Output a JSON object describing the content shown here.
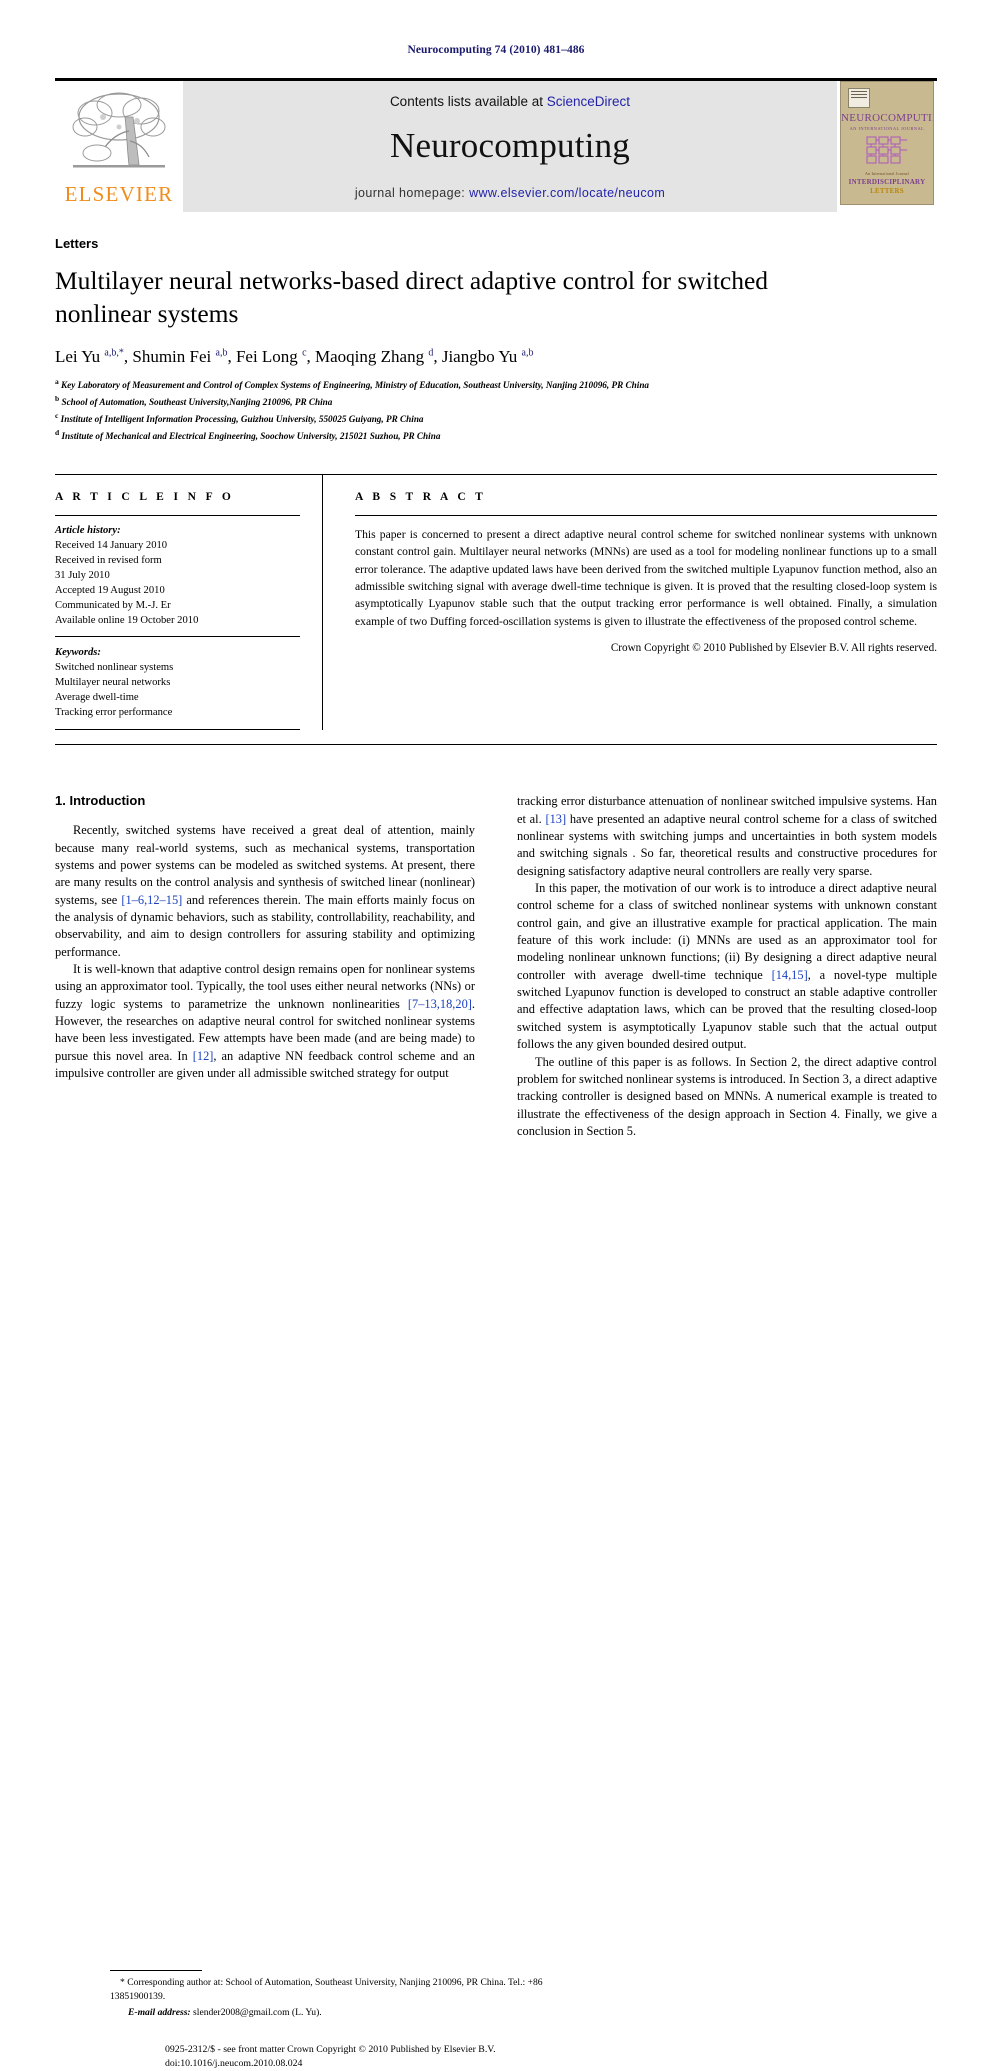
{
  "running_head": "Neurocomputing 74 (2010) 481–486",
  "masthead": {
    "publisher": "ELSEVIER",
    "contents_prefix": "Contents lists available at ",
    "contents_link": "ScienceDirect",
    "journal_name": "Neurocomputing",
    "homepage_prefix": "journal homepage: ",
    "homepage_url": "www.elsevier.com/locate/neucom",
    "cover": {
      "title": "NEUROCOMPUTING",
      "subtitle": "AN INTERNATIONAL JOURNAL",
      "foot_small": "An International Journal",
      "foot_line1": "INTERDISCIPLINARY",
      "foot_line2": "LETTERS"
    },
    "link_color": "#2222aa",
    "banner_color": "#e4e4e4",
    "elsevier_orange": "#F08C1B"
  },
  "article": {
    "kicker": "Letters",
    "title": "Multilayer neural networks-based direct adaptive control for switched nonlinear systems",
    "authors_html": "Lei Yu <sup>a,b,</sup><sup>*</sup>, Shumin Fei <sup>a,b</sup>, Fei Long <sup>c</sup>, Maoqing Zhang <sup>d</sup>, Jiangbo Yu <sup>a,b</sup>",
    "affiliations": [
      {
        "mark": "a",
        "text": "Key Laboratory of Measurement and Control of Complex Systems of Engineering, Ministry of Education, Southeast University, Nanjing 210096, PR China"
      },
      {
        "mark": "b",
        "text": "School of Automation, Southeast University,Nanjing 210096, PR China"
      },
      {
        "mark": "c",
        "text": "Institute of Intelligent Information Processing, Guizhou University, 550025 Guiyang, PR China"
      },
      {
        "mark": "d",
        "text": "Institute of Mechanical and Electrical Engineering, Soochow University, 215021 Suzhou, PR China"
      }
    ]
  },
  "article_info": {
    "heading": "A R T I C L E   I N F O",
    "history_label": "Article history:",
    "history": [
      "Received 14 January 2010",
      "Received in revised form",
      "31 July 2010",
      "Accepted 19 August 2010",
      "Communicated by M.-J. Er",
      "Available online 19 October 2010"
    ],
    "keywords_label": "Keywords:",
    "keywords": [
      "Switched nonlinear systems",
      "Multilayer neural networks",
      "Average dwell-time",
      "Tracking error performance"
    ]
  },
  "abstract": {
    "heading": "A B S T R A C T",
    "text": "This paper is concerned to present a direct adaptive neural control scheme for switched nonlinear systems with unknown constant control gain. Multilayer neural networks (MNNs) are used as a tool for modeling nonlinear functions up to a small error tolerance. The adaptive updated laws have been derived from the switched multiple Lyapunov function method, also an admissible switching signal with average dwell-time technique is given. It is proved that the resulting closed-loop system is asymptotically Lyapunov stable such that the output tracking error performance is well obtained. Finally, a simulation example of two Duffing forced-oscillation systems is given to illustrate the effectiveness of the proposed control scheme.",
    "copyright": "Crown Copyright © 2010 Published by Elsevier B.V. All rights reserved."
  },
  "body": {
    "section_heading": "1.  Introduction",
    "left_paragraphs": [
      "Recently, switched systems have received a great deal of attention, mainly because many real-world systems, such as mechanical systems, transportation systems and power systems can be modeled as switched systems. At present, there are many results on the control analysis and synthesis of switched linear (nonlinear) systems, see [1–6,12–15] and references therein. The main efforts mainly focus on the analysis of dynamic behaviors, such as stability, controllability, reachability, and observability, and aim to design controllers for assuring stability and optimizing performance.",
      "It is well-known that adaptive control design remains open for nonlinear systems using an approximator tool. Typically, the tool uses either neural networks (NNs) or fuzzy logic systems to parametrize the unknown nonlinearities [7–13,18,20]. However, the researches on adaptive neural control for switched nonlinear systems have been less investigated. Few attempts have been made (and are being made) to pursue this novel area. In [12], an adaptive NN feedback control scheme and an impulsive controller are given under all admissible switched strategy for output"
    ],
    "right_paragraphs": [
      "tracking error disturbance attenuation of nonlinear switched impulsive systems. Han et al. [13] have presented an adaptive neural control scheme for a class of switched nonlinear systems with switching jumps and uncertainties in both system models and switching signals . So far, theoretical results and constructive procedures for designing satisfactory adaptive neural controllers are really very sparse.",
      "In this paper, the motivation of our work is to introduce a direct adaptive neural control scheme for a class of switched nonlinear systems with unknown constant control gain, and give an illustrative example for practical application. The main feature of this work include: (i) MNNs are used as an approximator tool for modeling nonlinear unknown functions; (ii) By designing a direct adaptive neural controller with average dwell-time technique [14,15], a novel-type multiple switched Lyapunov function is developed to construct an stable adaptive controller and effective adaptation laws, which can be proved that the resulting closed-loop switched system is asymptotically Lyapunov stable such that the actual output follows the any given bounded desired output.",
      "The outline of this paper is as follows. In Section 2, the direct adaptive control problem for switched nonlinear systems is introduced. In Section 3, a direct adaptive tracking controller is designed based on MNNs. A numerical example is treated to illustrate the effectiveness of the design approach in Section 4. Finally, we give a conclusion in Section 5."
    ],
    "reference_color": "#1a3fbf"
  },
  "footnotes": {
    "corresponding": "* Corresponding author at: School of Automation, Southeast University, Nanjing 210096, PR China. Tel.: +86 13851900139.",
    "email_label": "E-mail address:",
    "email": " slender2008@gmail.com (L. Yu).",
    "imprint_line1": "0925-2312/$ - see front matter Crown Copyright © 2010 Published by Elsevier B.V.",
    "imprint_line2": "doi:10.1016/j.neucom.2010.08.024"
  }
}
